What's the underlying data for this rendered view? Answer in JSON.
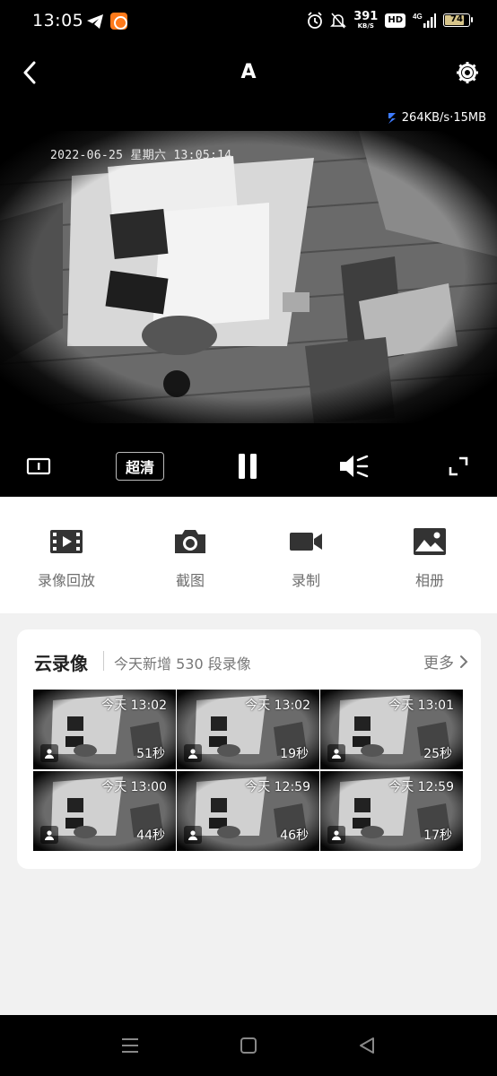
{
  "status_bar": {
    "time": "13:05",
    "net_speed_value": "391",
    "net_speed_unit": "KB/S",
    "hd_label": "HD",
    "signal_label": "4G",
    "battery": "74",
    "battery_level": 0.74
  },
  "header": {
    "title": "A",
    "back_icon": "chevron-left-icon",
    "settings_icon": "gear-icon"
  },
  "player": {
    "rate_text": "264KB/s·15MB",
    "osd_timestamp": "2022-06-25 星期六 13:05:14",
    "quality_label": "超清",
    "icons": [
      "info-icon",
      "pause-icon",
      "mute-icon",
      "fullscreen-icon"
    ]
  },
  "actions": [
    {
      "label": "录像回放",
      "icon": "film-icon"
    },
    {
      "label": "截图",
      "icon": "camera-icon"
    },
    {
      "label": "录制",
      "icon": "video-camera-icon"
    },
    {
      "label": "相册",
      "icon": "image-icon"
    }
  ],
  "cloud": {
    "title": "云录像",
    "subtitle": "今天新增 530 段录像",
    "more": "更多",
    "clips": [
      {
        "time": "今天 13:02",
        "duration": "51秒"
      },
      {
        "time": "今天 13:02",
        "duration": "19秒"
      },
      {
        "time": "今天 13:01",
        "duration": "25秒"
      },
      {
        "time": "今天 13:00",
        "duration": "44秒"
      },
      {
        "time": "今天 12:59",
        "duration": "46秒"
      },
      {
        "time": "今天 12:59",
        "duration": "17秒"
      }
    ]
  },
  "nav_bar": {
    "icons": [
      "menu-icon",
      "home-icon",
      "back-triangle-icon"
    ]
  },
  "colors": {
    "bar_bg": "#000000",
    "page_bg": "#f1f1f1",
    "card_bg": "#ffffff",
    "label_gray": "#6e6e6e",
    "app_badge": "#ff7a1a"
  }
}
